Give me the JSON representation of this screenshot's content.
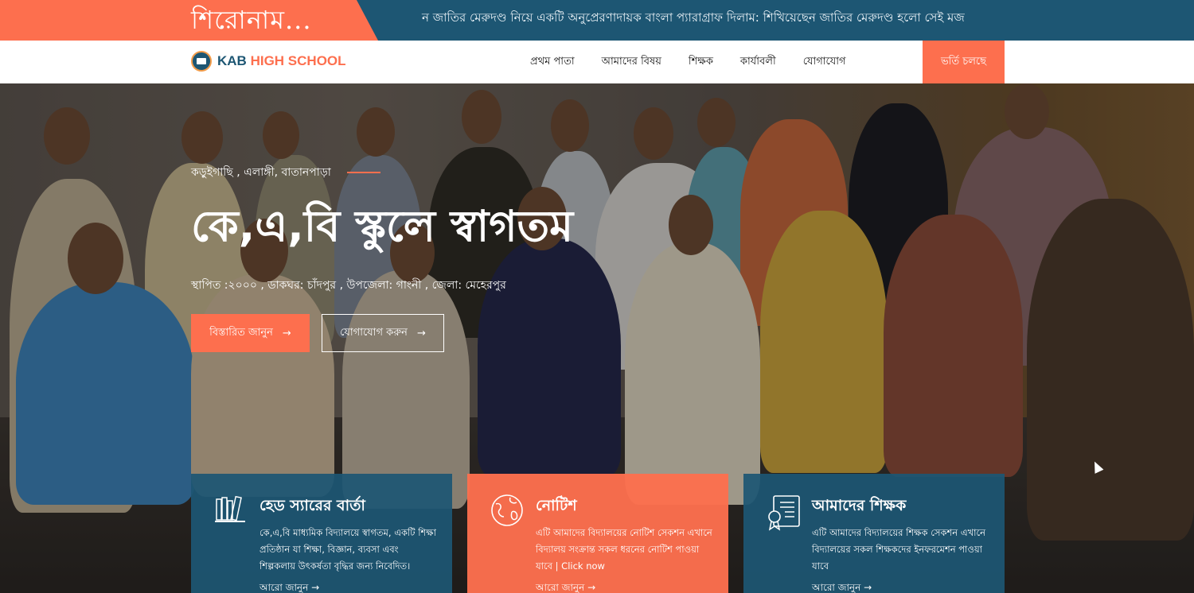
{
  "ticker": {
    "label": "শিরোনাম...",
    "text": "ন জাতির মেরুদণ্ড নিয়ে একটি অনুপ্রেরণাদায়ক বাংলা প্যারাগ্রাফ দিলাম: শিখিয়েছেন জাতির মেরুদণ্ড হলো সেই মজ",
    "colors": {
      "bar": "#1d5673",
      "label_bg": "#fd6f4e"
    }
  },
  "navbar": {
    "logo": {
      "kab": "KAB",
      "school": "HIGH SCHOOL"
    },
    "links": [
      "প্রথম পাতা",
      "আমাদের বিষয়",
      "শিক্ষক",
      "কার্যাবলী",
      "যোগাযোগ"
    ],
    "admission": "ভর্তি চলছে"
  },
  "hero": {
    "location": "কড়ুইগাছি , এলাঙ্গী, বাতানপাড়া",
    "title": "কে,এ,বি স্কুলে স্বাগতম",
    "subtitle": "স্থাপিত :২০০০ , ডাকঘর: চাঁদপুর , উপজেলা: গাংনী , জেলা: মেহেরপুর",
    "btn_primary": "বিস্তারিত জানুন",
    "btn_outline": "যোগাযোগ করুন",
    "arrow": "→"
  },
  "cards": [
    {
      "icon": "books-icon",
      "title": "হেড স্যারের বার্তা",
      "text": "কে,এ,বি মাধ্যমিক বিদ্যালয়ে স্বাগতম, একটি শিক্ষা প্রতিষ্ঠান যা শিক্ষা, বিজ্ঞান, ব্যবসা এবং শিল্পকলায় উৎকর্ষতা বৃদ্ধির জন্য নিবেদিত।",
      "link": "আরো জানুন →",
      "color": "blue"
    },
    {
      "icon": "globe-icon",
      "title": "নোটিশ",
      "text": "এটি আমাদের বিদ্যালয়ের নোটিশ সেকশন এখানে বিদ্যালয় সংক্রান্ত সকল ধরনের নোটিশ পাওয়া যাবে | Click now",
      "link": "আরো জানুন →",
      "color": "orange"
    },
    {
      "icon": "certificate-icon",
      "title": "আমাদের শিক্ষক",
      "text": "এটি আমাদের বিদ্যালয়ের শিক্ষক সেকশন এখানে বিদ্যালয়ের সকল শিক্ষকদের ইনফরমেশন পাওয়া যাবে",
      "link": "আরো জানুন →",
      "color": "blue"
    }
  ],
  "colors": {
    "primary": "#1d5673",
    "accent": "#fd6f4e"
  }
}
